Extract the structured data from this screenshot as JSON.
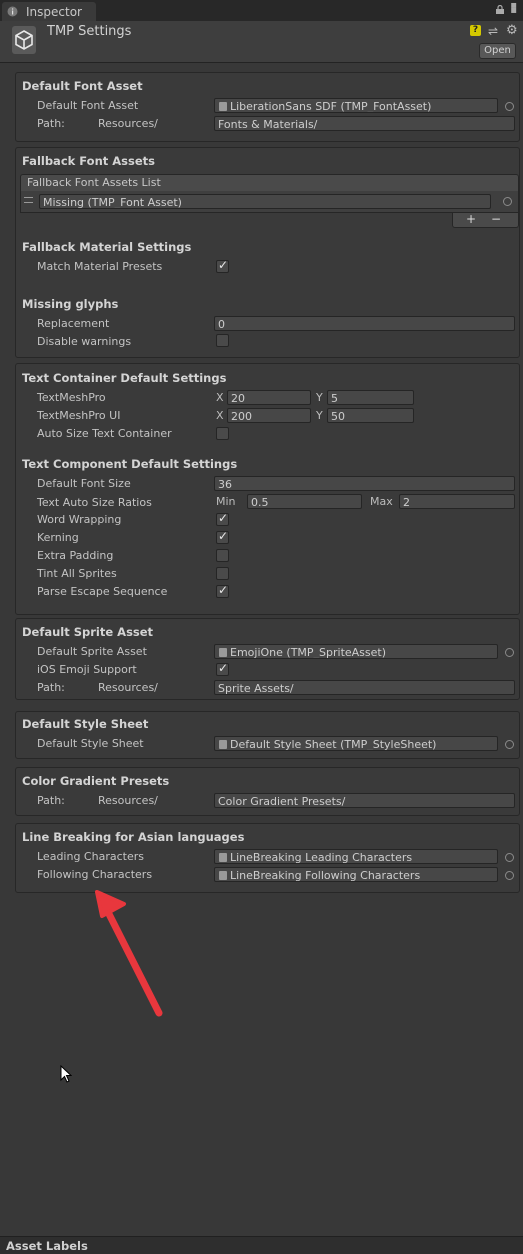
{
  "tab": {
    "label": "Inspector",
    "icon": "info-icon"
  },
  "header": {
    "title": "TMP Settings",
    "open_button": "Open",
    "icons": [
      "help-icon",
      "preset-icon",
      "gear-icon"
    ]
  },
  "sections": {
    "default_font_asset": {
      "title": "Default Font Asset",
      "font_label": "Default Font Asset",
      "font_value": "LiberationSans SDF (TMP_FontAsset)",
      "path_label": "Path:",
      "path_prefix": "Resources/",
      "path_value": "Fonts & Materials/"
    },
    "fallback_fonts": {
      "title": "Fallback Font Assets",
      "list_header": "Fallback Font Assets List",
      "item": "Missing (TMP_Font Asset)",
      "add": "+",
      "remove": "−"
    },
    "fallback_material": {
      "title": "Fallback Material Settings",
      "match_label": "Match Material Presets",
      "match_checked": true
    },
    "missing_glyphs": {
      "title": "Missing glyphs",
      "replacement_label": "Replacement",
      "replacement_value": "0",
      "disable_label": "Disable warnings",
      "disable_checked": false
    },
    "text_container": {
      "title": "Text Container Default Settings",
      "tmp_label": "TextMeshPro",
      "tmp_x": "20",
      "tmp_y": "5",
      "tmpui_label": "TextMeshPro UI",
      "tmpui_x": "200",
      "tmpui_y": "50",
      "x_axis": "X",
      "y_axis": "Y",
      "autosize_label": "Auto Size Text Container",
      "autosize_checked": false
    },
    "text_component": {
      "title": "Text Component Default Settings",
      "font_size_label": "Default Font Size",
      "font_size_value": "36",
      "ratios_label": "Text Auto Size Ratios",
      "min_label": "Min",
      "min_value": "0.5",
      "max_label": "Max",
      "max_value": "2",
      "word_wrap_label": "Word Wrapping",
      "word_wrap_checked": true,
      "kerning_label": "Kerning",
      "kerning_checked": true,
      "extra_padding_label": "Extra Padding",
      "extra_padding_checked": false,
      "tint_label": "Tint All Sprites",
      "tint_checked": false,
      "escape_label": "Parse Escape Sequence",
      "escape_checked": true
    },
    "sprite_asset": {
      "title": "Default Sprite Asset",
      "sprite_label": "Default Sprite Asset",
      "sprite_value": "EmojiOne (TMP_SpriteAsset)",
      "emoji_label": "iOS Emoji Support",
      "emoji_checked": true,
      "path_label": "Path:",
      "path_prefix": "Resources/",
      "path_value": "Sprite Assets/"
    },
    "style_sheet": {
      "title": "Default Style Sheet",
      "sheet_label": "Default Style Sheet",
      "sheet_value": "Default Style Sheet (TMP_StyleSheet)"
    },
    "color_gradient": {
      "title": "Color Gradient Presets",
      "path_label": "Path:",
      "path_prefix": "Resources/",
      "path_value": "Color Gradient Presets/"
    },
    "line_breaking": {
      "title": "Line Breaking for Asian languages",
      "leading_label": "Leading Characters",
      "leading_value": "LineBreaking Leading Characters",
      "following_label": "Following Characters",
      "following_value": "LineBreaking Following Characters"
    }
  },
  "annotation": {
    "arrow_color": "#e8373d"
  },
  "footer": {
    "asset_labels": "Asset Labels"
  }
}
